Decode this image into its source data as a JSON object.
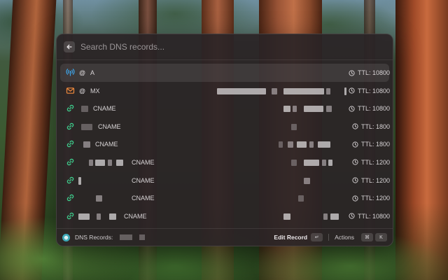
{
  "search": {
    "placeholder": "Search DNS records..."
  },
  "records": [
    {
      "icon": "broadcast-icon",
      "icon_color": "#3ea3e6",
      "at": "@",
      "type": "A",
      "ttl": "TTL: 10800"
    },
    {
      "icon": "mail-icon",
      "icon_color": "#f08a3c",
      "at": "@",
      "type": "MX",
      "ttl": "TTL: 10800"
    },
    {
      "icon": "link-icon",
      "icon_color": "#3ed08e",
      "at": "",
      "type": "CNAME",
      "ttl": "TTL: 10800"
    },
    {
      "icon": "link-icon",
      "icon_color": "#3ed08e",
      "at": "",
      "type": "CNAME",
      "ttl": "TTL: 1800"
    },
    {
      "icon": "link-icon",
      "icon_color": "#3ed08e",
      "at": "",
      "type": "CNAME",
      "ttl": "TTL: 1800"
    },
    {
      "icon": "link-icon",
      "icon_color": "#3ed08e",
      "at": "",
      "type": "CNAME",
      "ttl": "TTL: 1200"
    },
    {
      "icon": "link-icon",
      "icon_color": "#3ed08e",
      "at": "",
      "type": "CNAME",
      "ttl": "TTL: 1200"
    },
    {
      "icon": "link-icon",
      "icon_color": "#3ed08e",
      "at": "",
      "type": "CNAME",
      "ttl": "TTL: 1200"
    },
    {
      "icon": "link-icon",
      "icon_color": "#3ed08e",
      "at": "",
      "type": "CNAME",
      "ttl": "TTL: 10800"
    }
  ],
  "footer": {
    "title": "DNS Records:",
    "primary_action": "Edit Record",
    "primary_shortcut": "↵",
    "actions_label": "Actions",
    "actions_shortcut_mod": "⌘",
    "actions_shortcut_key": "K"
  },
  "colors": {
    "accent_dns": "#3fa9b8",
    "selected_row": "rgba(255,255,255,0.09)"
  }
}
